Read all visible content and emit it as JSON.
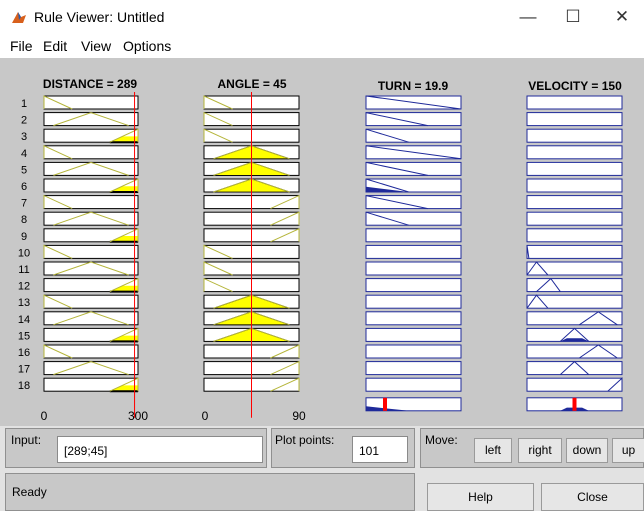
{
  "window": {
    "title": "Rule Viewer: Untitled",
    "minimize_glyph": "—",
    "maximize_glyph": "☐",
    "close_glyph": "✕"
  },
  "menu": [
    "File",
    "Edit",
    "View",
    "Options"
  ],
  "headers": {
    "distance": "DISTANCE = 289",
    "angle": "ANGLE = 45",
    "turn": "TURN = 19.9",
    "velocity": "VELOCITY = 150"
  },
  "axes": {
    "distance": {
      "min": "0",
      "max": "300",
      "range": [
        0,
        300
      ]
    },
    "angle": {
      "min": "0",
      "max": "90",
      "range": [
        0,
        90
      ]
    }
  },
  "current": {
    "distance": 289,
    "angle": 45
  },
  "rule_numbers": [
    "1",
    "2",
    "3",
    "4",
    "5",
    "6",
    "7",
    "8",
    "9",
    "10",
    "11",
    "12",
    "13",
    "14",
    "15",
    "16",
    "17",
    "18"
  ],
  "rules": [
    {
      "d": "z",
      "a": "z",
      "t": "r1",
      "v": "n"
    },
    {
      "d": "m",
      "a": "z",
      "t": "r2",
      "v": "n"
    },
    {
      "d": "f",
      "a": "z",
      "t": "r3",
      "v": "n"
    },
    {
      "d": "z",
      "a": "m",
      "t": "r1",
      "v": "n"
    },
    {
      "d": "m",
      "a": "m",
      "t": "r2",
      "v": "n"
    },
    {
      "d": "f",
      "a": "m",
      "t": "r3",
      "v": "n"
    },
    {
      "d": "z",
      "a": "f",
      "t": "r2",
      "v": "n"
    },
    {
      "d": "m",
      "a": "f",
      "t": "r3",
      "v": "n"
    },
    {
      "d": "f",
      "a": "f",
      "t": "n",
      "v": "n"
    },
    {
      "d": "z",
      "a": "z",
      "t": "n",
      "v": "v1"
    },
    {
      "d": "m",
      "a": "z",
      "t": "n",
      "v": "v2"
    },
    {
      "d": "f",
      "a": "z",
      "t": "n",
      "v": "v3"
    },
    {
      "d": "z",
      "a": "m",
      "t": "n",
      "v": "v2"
    },
    {
      "d": "m",
      "a": "m",
      "t": "n",
      "v": "v4"
    },
    {
      "d": "f",
      "a": "m",
      "t": "n",
      "v": "v5"
    },
    {
      "d": "z",
      "a": "f",
      "t": "n",
      "v": "v4"
    },
    {
      "d": "m",
      "a": "f",
      "t": "n",
      "v": "v5"
    },
    {
      "d": "f",
      "a": "f",
      "t": "n",
      "v": "v6"
    }
  ],
  "aggregate": {
    "turn_output_fraction": 0.2,
    "velocity_output_fraction": 0.5
  },
  "colors": {
    "background": "#c8c8c8",
    "input_mf": "#b5b53a",
    "input_fill": "#ffff00",
    "output_mf": "#1f2a9a",
    "marker": "#ff0000"
  },
  "controls": {
    "input_label": "Input:",
    "input_value": "[289;45]",
    "plot_points_label": "Plot points:",
    "plot_points_value": "101",
    "move_label": "Move:",
    "left": "left",
    "right": "right",
    "down": "down",
    "up": "up",
    "status": "Ready",
    "help": "Help",
    "close": "Close"
  }
}
